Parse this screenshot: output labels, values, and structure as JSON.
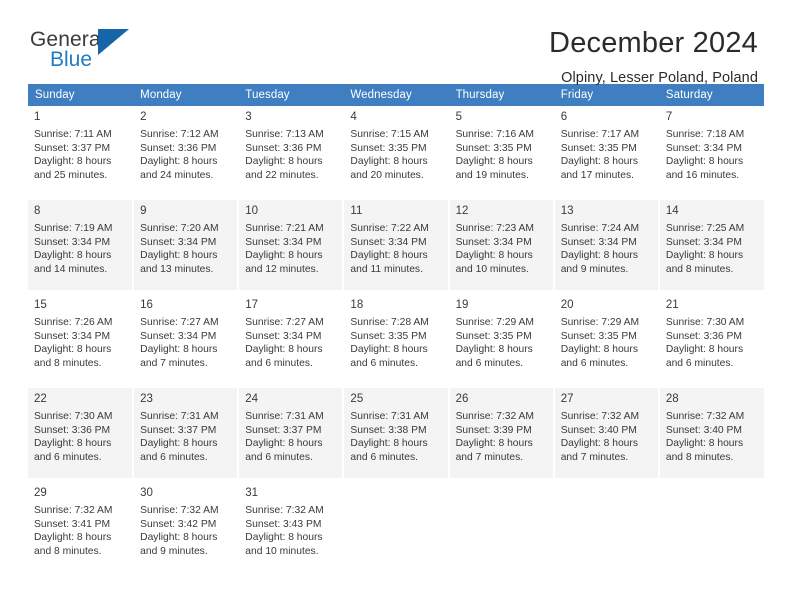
{
  "brand": {
    "name_top": "General",
    "name_bottom": "Blue",
    "flag_icon": "brand-flag-triangle",
    "colors": {
      "general": "#3b3b3b",
      "blue": "#1f7cc4",
      "flag": "#1565a8"
    }
  },
  "header": {
    "month_title": "December 2024",
    "location": "Olpiny, Lesser Poland, Poland"
  },
  "calendar": {
    "header_bg": "#3f7fc1",
    "shaded_row_bg": "#f4f4f4",
    "weekday_headers": [
      "Sunday",
      "Monday",
      "Tuesday",
      "Wednesday",
      "Thursday",
      "Friday",
      "Saturday"
    ],
    "weeks": [
      {
        "shaded": false,
        "days": [
          {
            "num": "1",
            "sunrise": "Sunrise: 7:11 AM",
            "sunset": "Sunset: 3:37 PM",
            "daylight1": "Daylight: 8 hours",
            "daylight2": "and 25 minutes."
          },
          {
            "num": "2",
            "sunrise": "Sunrise: 7:12 AM",
            "sunset": "Sunset: 3:36 PM",
            "daylight1": "Daylight: 8 hours",
            "daylight2": "and 24 minutes."
          },
          {
            "num": "3",
            "sunrise": "Sunrise: 7:13 AM",
            "sunset": "Sunset: 3:36 PM",
            "daylight1": "Daylight: 8 hours",
            "daylight2": "and 22 minutes."
          },
          {
            "num": "4",
            "sunrise": "Sunrise: 7:15 AM",
            "sunset": "Sunset: 3:35 PM",
            "daylight1": "Daylight: 8 hours",
            "daylight2": "and 20 minutes."
          },
          {
            "num": "5",
            "sunrise": "Sunrise: 7:16 AM",
            "sunset": "Sunset: 3:35 PM",
            "daylight1": "Daylight: 8 hours",
            "daylight2": "and 19 minutes."
          },
          {
            "num": "6",
            "sunrise": "Sunrise: 7:17 AM",
            "sunset": "Sunset: 3:35 PM",
            "daylight1": "Daylight: 8 hours",
            "daylight2": "and 17 minutes."
          },
          {
            "num": "7",
            "sunrise": "Sunrise: 7:18 AM",
            "sunset": "Sunset: 3:34 PM",
            "daylight1": "Daylight: 8 hours",
            "daylight2": "and 16 minutes."
          }
        ]
      },
      {
        "shaded": true,
        "days": [
          {
            "num": "8",
            "sunrise": "Sunrise: 7:19 AM",
            "sunset": "Sunset: 3:34 PM",
            "daylight1": "Daylight: 8 hours",
            "daylight2": "and 14 minutes."
          },
          {
            "num": "9",
            "sunrise": "Sunrise: 7:20 AM",
            "sunset": "Sunset: 3:34 PM",
            "daylight1": "Daylight: 8 hours",
            "daylight2": "and 13 minutes."
          },
          {
            "num": "10",
            "sunrise": "Sunrise: 7:21 AM",
            "sunset": "Sunset: 3:34 PM",
            "daylight1": "Daylight: 8 hours",
            "daylight2": "and 12 minutes."
          },
          {
            "num": "11",
            "sunrise": "Sunrise: 7:22 AM",
            "sunset": "Sunset: 3:34 PM",
            "daylight1": "Daylight: 8 hours",
            "daylight2": "and 11 minutes."
          },
          {
            "num": "12",
            "sunrise": "Sunrise: 7:23 AM",
            "sunset": "Sunset: 3:34 PM",
            "daylight1": "Daylight: 8 hours",
            "daylight2": "and 10 minutes."
          },
          {
            "num": "13",
            "sunrise": "Sunrise: 7:24 AM",
            "sunset": "Sunset: 3:34 PM",
            "daylight1": "Daylight: 8 hours",
            "daylight2": "and 9 minutes."
          },
          {
            "num": "14",
            "sunrise": "Sunrise: 7:25 AM",
            "sunset": "Sunset: 3:34 PM",
            "daylight1": "Daylight: 8 hours",
            "daylight2": "and 8 minutes."
          }
        ]
      },
      {
        "shaded": false,
        "days": [
          {
            "num": "15",
            "sunrise": "Sunrise: 7:26 AM",
            "sunset": "Sunset: 3:34 PM",
            "daylight1": "Daylight: 8 hours",
            "daylight2": "and 8 minutes."
          },
          {
            "num": "16",
            "sunrise": "Sunrise: 7:27 AM",
            "sunset": "Sunset: 3:34 PM",
            "daylight1": "Daylight: 8 hours",
            "daylight2": "and 7 minutes."
          },
          {
            "num": "17",
            "sunrise": "Sunrise: 7:27 AM",
            "sunset": "Sunset: 3:34 PM",
            "daylight1": "Daylight: 8 hours",
            "daylight2": "and 6 minutes."
          },
          {
            "num": "18",
            "sunrise": "Sunrise: 7:28 AM",
            "sunset": "Sunset: 3:35 PM",
            "daylight1": "Daylight: 8 hours",
            "daylight2": "and 6 minutes."
          },
          {
            "num": "19",
            "sunrise": "Sunrise: 7:29 AM",
            "sunset": "Sunset: 3:35 PM",
            "daylight1": "Daylight: 8 hours",
            "daylight2": "and 6 minutes."
          },
          {
            "num": "20",
            "sunrise": "Sunrise: 7:29 AM",
            "sunset": "Sunset: 3:35 PM",
            "daylight1": "Daylight: 8 hours",
            "daylight2": "and 6 minutes."
          },
          {
            "num": "21",
            "sunrise": "Sunrise: 7:30 AM",
            "sunset": "Sunset: 3:36 PM",
            "daylight1": "Daylight: 8 hours",
            "daylight2": "and 6 minutes."
          }
        ]
      },
      {
        "shaded": true,
        "days": [
          {
            "num": "22",
            "sunrise": "Sunrise: 7:30 AM",
            "sunset": "Sunset: 3:36 PM",
            "daylight1": "Daylight: 8 hours",
            "daylight2": "and 6 minutes."
          },
          {
            "num": "23",
            "sunrise": "Sunrise: 7:31 AM",
            "sunset": "Sunset: 3:37 PM",
            "daylight1": "Daylight: 8 hours",
            "daylight2": "and 6 minutes."
          },
          {
            "num": "24",
            "sunrise": "Sunrise: 7:31 AM",
            "sunset": "Sunset: 3:37 PM",
            "daylight1": "Daylight: 8 hours",
            "daylight2": "and 6 minutes."
          },
          {
            "num": "25",
            "sunrise": "Sunrise: 7:31 AM",
            "sunset": "Sunset: 3:38 PM",
            "daylight1": "Daylight: 8 hours",
            "daylight2": "and 6 minutes."
          },
          {
            "num": "26",
            "sunrise": "Sunrise: 7:32 AM",
            "sunset": "Sunset: 3:39 PM",
            "daylight1": "Daylight: 8 hours",
            "daylight2": "and 7 minutes."
          },
          {
            "num": "27",
            "sunrise": "Sunrise: 7:32 AM",
            "sunset": "Sunset: 3:40 PM",
            "daylight1": "Daylight: 8 hours",
            "daylight2": "and 7 minutes."
          },
          {
            "num": "28",
            "sunrise": "Sunrise: 7:32 AM",
            "sunset": "Sunset: 3:40 PM",
            "daylight1": "Daylight: 8 hours",
            "daylight2": "and 8 minutes."
          }
        ]
      },
      {
        "shaded": false,
        "days": [
          {
            "num": "29",
            "sunrise": "Sunrise: 7:32 AM",
            "sunset": "Sunset: 3:41 PM",
            "daylight1": "Daylight: 8 hours",
            "daylight2": "and 8 minutes."
          },
          {
            "num": "30",
            "sunrise": "Sunrise: 7:32 AM",
            "sunset": "Sunset: 3:42 PM",
            "daylight1": "Daylight: 8 hours",
            "daylight2": "and 9 minutes."
          },
          {
            "num": "31",
            "sunrise": "Sunrise: 7:32 AM",
            "sunset": "Sunset: 3:43 PM",
            "daylight1": "Daylight: 8 hours",
            "daylight2": "and 10 minutes."
          },
          {
            "num": "",
            "sunrise": "",
            "sunset": "",
            "daylight1": "",
            "daylight2": ""
          },
          {
            "num": "",
            "sunrise": "",
            "sunset": "",
            "daylight1": "",
            "daylight2": ""
          },
          {
            "num": "",
            "sunrise": "",
            "sunset": "",
            "daylight1": "",
            "daylight2": ""
          },
          {
            "num": "",
            "sunrise": "",
            "sunset": "",
            "daylight1": "",
            "daylight2": ""
          }
        ]
      }
    ]
  }
}
